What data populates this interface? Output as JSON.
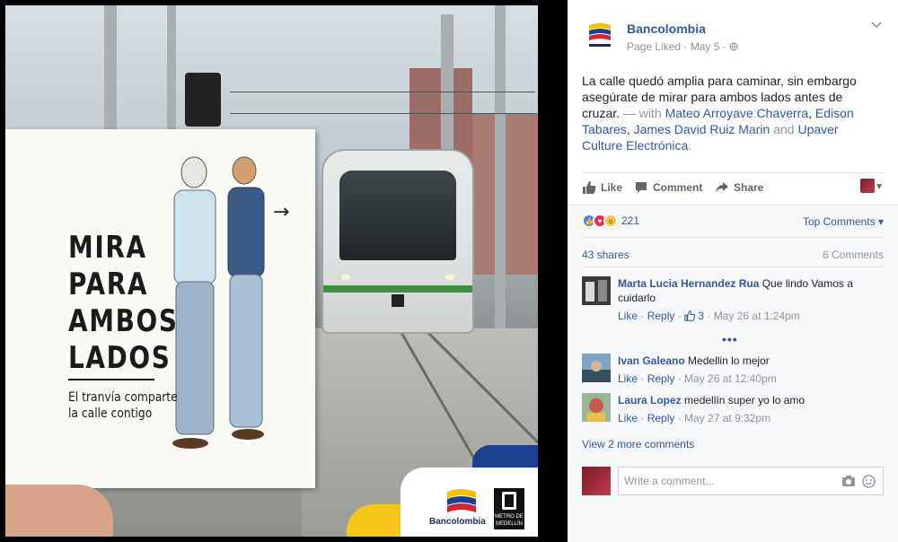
{
  "photo": {
    "card_title_lines": [
      "MIRA",
      "PARA",
      "AMBOS",
      "LADOS"
    ],
    "card_subtitle_lines": [
      "El tranvía comparte",
      "la calle contigo"
    ],
    "arrow": "→",
    "bank_logo_text": "Bancolombia",
    "metro_logo_text": "METRO DE MEDELLÍN"
  },
  "post": {
    "page_name": "Bancolombia",
    "meta": "Page Liked · May 5 · ",
    "text": "La calle quedó amplia para caminar, sin embargo asegúrate de mirar para ambos lados antes de cruzar.",
    "with_label": " — with ",
    "tagged": [
      "Mateo Arroyave Chaverra",
      "Edison Tabares",
      "James David Ruiz Marin",
      "Upaver Culture Electrónica"
    ],
    "and_label": " and ",
    "end": "."
  },
  "actions": {
    "like": "Like",
    "comment": "Comment",
    "share": "Share"
  },
  "reactions": {
    "count": "221",
    "top_comments": "Top Comments"
  },
  "stats": {
    "shares": "43 shares",
    "comments": "6 Comments"
  },
  "comments": [
    {
      "name": "Marta Lucia Hernandez Rua",
      "text": "Que lindo Vamos a cuidarlo",
      "like": "Like",
      "reply": "Reply",
      "likes": "3",
      "time": "May 26 at 1:24pm"
    },
    {
      "name": "Ivan Galeano",
      "text": "Medellin lo mejor",
      "like": "Like",
      "reply": "Reply",
      "time": "May 26 at 12:40pm"
    },
    {
      "name": "Laura Lopez",
      "text": "medellín super yo lo amo",
      "like": "Like",
      "reply": "Reply",
      "time": "May 27 at 9:32pm"
    }
  ],
  "more_dots": "•••",
  "view_more": "View 2 more comments",
  "composer": {
    "placeholder": "Write a comment..."
  },
  "colors": {
    "link": "#365899",
    "meta": "#90949c",
    "accent_like": "#4a7ff4"
  }
}
